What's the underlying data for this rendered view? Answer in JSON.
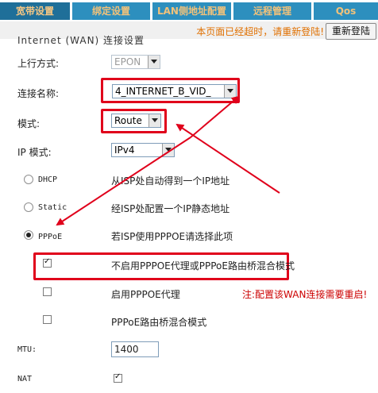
{
  "tabs": [
    {
      "label": "宽带设置",
      "active": true
    },
    {
      "label": "绑定设置",
      "active": false
    },
    {
      "label": "LAN侧地址配置",
      "active": false
    },
    {
      "label": "远程管理",
      "active": false
    },
    {
      "label": "Qos",
      "active": false
    }
  ],
  "notice": {
    "text": "本页面已经超时，请重新登陆!",
    "relogin_label": "重新登陆"
  },
  "section_title_partial": "Internet (WAN) 连接设置",
  "form": {
    "uplink": {
      "label": "上行方式:",
      "value": "EPON"
    },
    "connection": {
      "label": "连接名称:",
      "value": "4_INTERNET_B_VID_"
    },
    "mode": {
      "label": "模式:",
      "value": "Route"
    },
    "ip_mode": {
      "label": "IP 模式:",
      "value": "IPv4"
    },
    "dhcp": {
      "label": "DHCP",
      "desc": "从ISP处自动得到一个IP地址",
      "selected": false
    },
    "static": {
      "label": "Static",
      "desc": "经ISP处配置一个IP静态地址",
      "selected": false
    },
    "pppoe": {
      "label": "PPPoE",
      "desc": "若ISP使用PPPOE请选择此项",
      "selected": true
    },
    "opt_disable_proxy": {
      "label": "不启用PPPOE代理或PPPoE路由桥混合模式",
      "checked": true
    },
    "opt_enable_proxy": {
      "label": "启用PPPOE代理",
      "checked": false
    },
    "opt_bridge_mixed": {
      "label": "PPPoE路由桥混合模式",
      "checked": false
    },
    "restart_note": "注:配置该WAN连接需要重启!",
    "mtu": {
      "label": "MTU:",
      "value": "1400"
    },
    "nat": {
      "label": "NAT",
      "checked": true
    }
  },
  "colors": {
    "tab_bg": "#2d8fbe",
    "tab_text": "#f2c27a",
    "highlight": "#e0001b",
    "notice_text": "#e07000"
  }
}
